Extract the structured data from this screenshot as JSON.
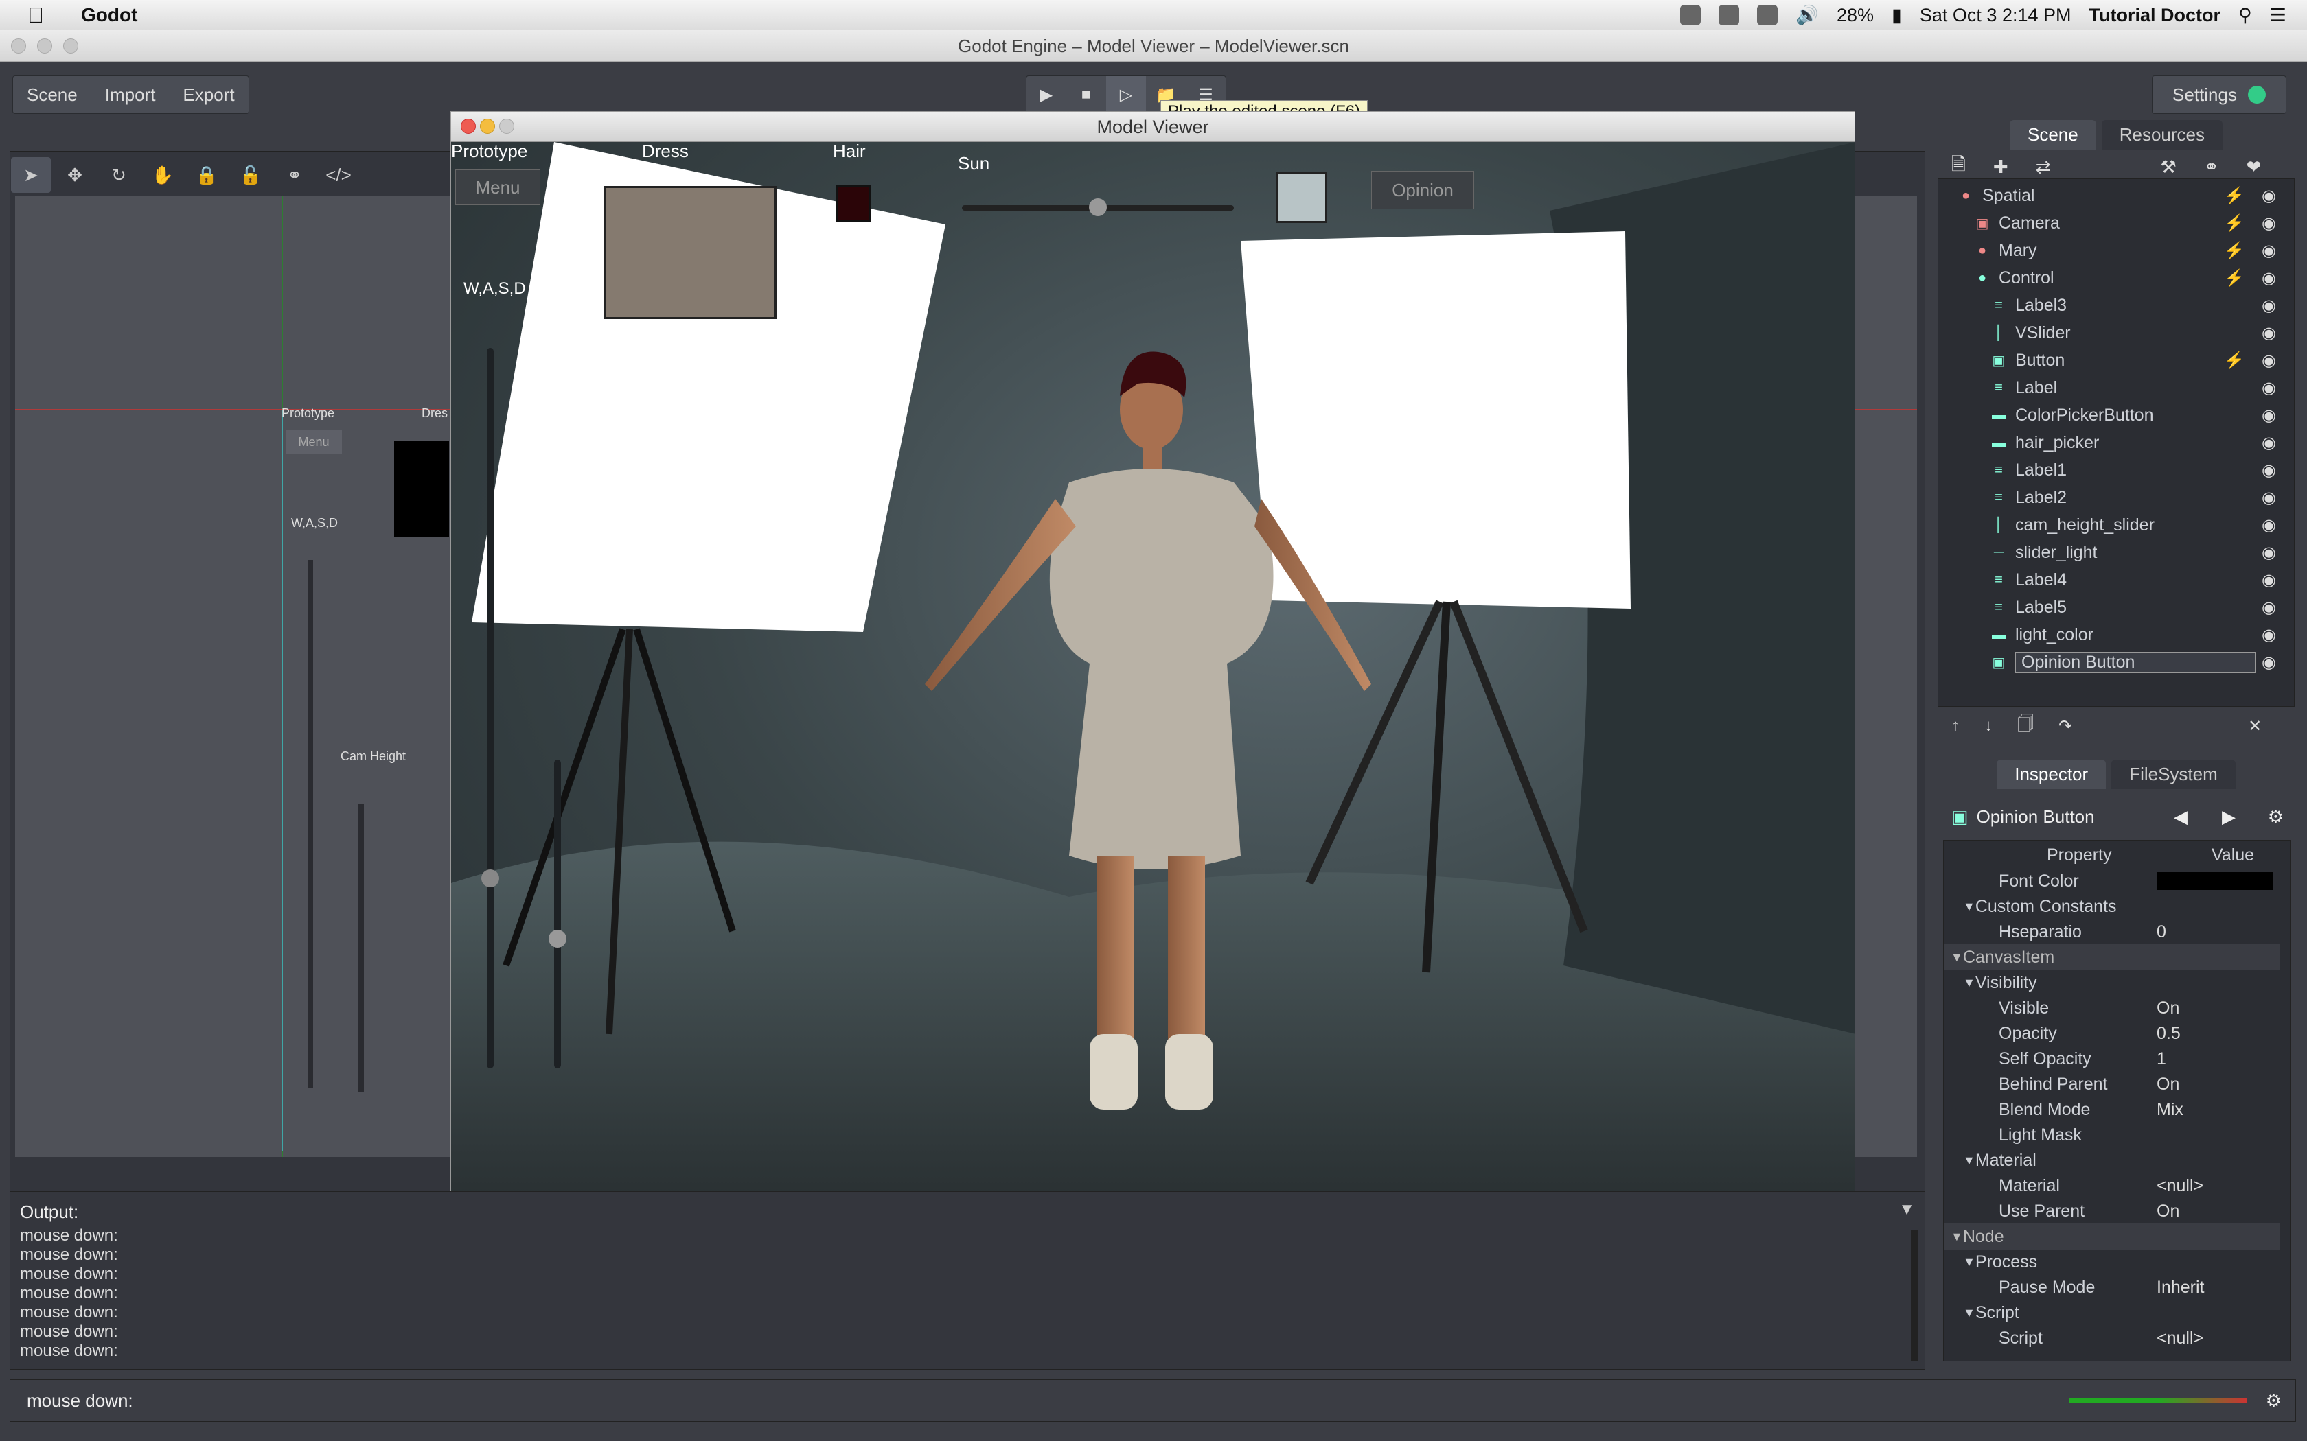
{
  "menubar": {
    "app_name": "Godot",
    "battery": "28%",
    "datetime": "Sat Oct 3  2:14 PM",
    "user": "Tutorial Doctor"
  },
  "window": {
    "title": "Godot Engine – Model Viewer – ModelViewer.scn"
  },
  "top_menu": {
    "scene": "Scene",
    "import": "Import",
    "export": "Export",
    "settings": "Settings"
  },
  "play_tooltip": "Play the edited scene (F6)",
  "viewport_labels": {
    "prototype": "Prototype",
    "dress": "Dres",
    "menu": "Menu",
    "wasd": "W,A,S,D",
    "cam_height": "Cam Height"
  },
  "model_viewer": {
    "title": "Model Viewer",
    "prototype": "Prototype",
    "dress": "Dress",
    "hair": "Hair",
    "sun": "Sun",
    "menu": "Menu",
    "opinion": "Opinion",
    "wasd": "W,A,S,D",
    "colors": {
      "dress": "#857a6f",
      "hair": "#2b0508",
      "light": "#b8c4c6"
    }
  },
  "scene_tabs": {
    "scene": "Scene",
    "resources": "Resources"
  },
  "scene_tree": [
    {
      "name": "Spatial",
      "icon": "spatial-icon",
      "script": true
    },
    {
      "name": "Camera",
      "icon": "camera-icon",
      "script": true
    },
    {
      "name": "Mary",
      "icon": "spatial-icon",
      "script": true
    },
    {
      "name": "Control",
      "icon": "control-icon",
      "script": true
    },
    {
      "name": "Label3",
      "icon": "label-icon",
      "script": false
    },
    {
      "name": "VSlider",
      "icon": "vslider-icon",
      "script": false
    },
    {
      "name": "Button",
      "icon": "button-icon",
      "script": true
    },
    {
      "name": "Label",
      "icon": "label-icon",
      "script": false
    },
    {
      "name": "ColorPickerButton",
      "icon": "colorpicker-icon",
      "script": false
    },
    {
      "name": "hair_picker",
      "icon": "colorpicker-icon",
      "script": false
    },
    {
      "name": "Label1",
      "icon": "label-icon",
      "script": false
    },
    {
      "name": "Label2",
      "icon": "label-icon",
      "script": false
    },
    {
      "name": "cam_height_slider",
      "icon": "vslider-icon",
      "script": false
    },
    {
      "name": "slider_light",
      "icon": "hslider-icon",
      "script": false
    },
    {
      "name": "Label4",
      "icon": "label-icon",
      "script": false
    },
    {
      "name": "Label5",
      "icon": "label-icon",
      "script": false
    },
    {
      "name": "light_color",
      "icon": "colorpicker-icon",
      "script": false
    },
    {
      "name": "Opinion Button",
      "icon": "button-icon",
      "script": false
    }
  ],
  "inspector_tabs": {
    "inspector": "Inspector",
    "filesystem": "FileSystem"
  },
  "inspector": {
    "node": "Opinion Button",
    "col_property": "Property",
    "col_value": "Value",
    "rows": [
      {
        "label": "Font Color",
        "value": "",
        "type": "prop"
      },
      {
        "label": "Custom Constants",
        "value": "",
        "type": "sub"
      },
      {
        "label": "Hseparatio",
        "value": "0",
        "type": "prop"
      },
      {
        "label": "CanvasItem",
        "value": "",
        "type": "sect"
      },
      {
        "label": "Visibility",
        "value": "",
        "type": "sub"
      },
      {
        "label": "Visible",
        "value": "On",
        "type": "prop"
      },
      {
        "label": "Opacity",
        "value": "0.5",
        "type": "prop"
      },
      {
        "label": "Self Opacity",
        "value": "1",
        "type": "prop"
      },
      {
        "label": "Behind Parent",
        "value": "On",
        "type": "prop"
      },
      {
        "label": "Blend Mode",
        "value": "Mix",
        "type": "prop"
      },
      {
        "label": "Light Mask",
        "value": "",
        "type": "prop"
      },
      {
        "label": "Material",
        "value": "",
        "type": "sub"
      },
      {
        "label": "Material",
        "value": "<null>",
        "type": "prop"
      },
      {
        "label": "Use Parent",
        "value": "On",
        "type": "prop"
      },
      {
        "label": "Node",
        "value": "",
        "type": "sect"
      },
      {
        "label": "Process",
        "value": "",
        "type": "sub"
      },
      {
        "label": "Pause Mode",
        "value": "Inherit",
        "type": "prop"
      },
      {
        "label": "Script",
        "value": "",
        "type": "sub"
      },
      {
        "label": "Script",
        "value": "<null>",
        "type": "prop"
      }
    ]
  },
  "output": {
    "label": "Output:",
    "lines": [
      "mouse down:",
      "mouse down:",
      "mouse down:",
      "mouse down:",
      "mouse down:",
      "mouse down:",
      "mouse down:"
    ]
  },
  "status": {
    "text": "mouse down:"
  }
}
